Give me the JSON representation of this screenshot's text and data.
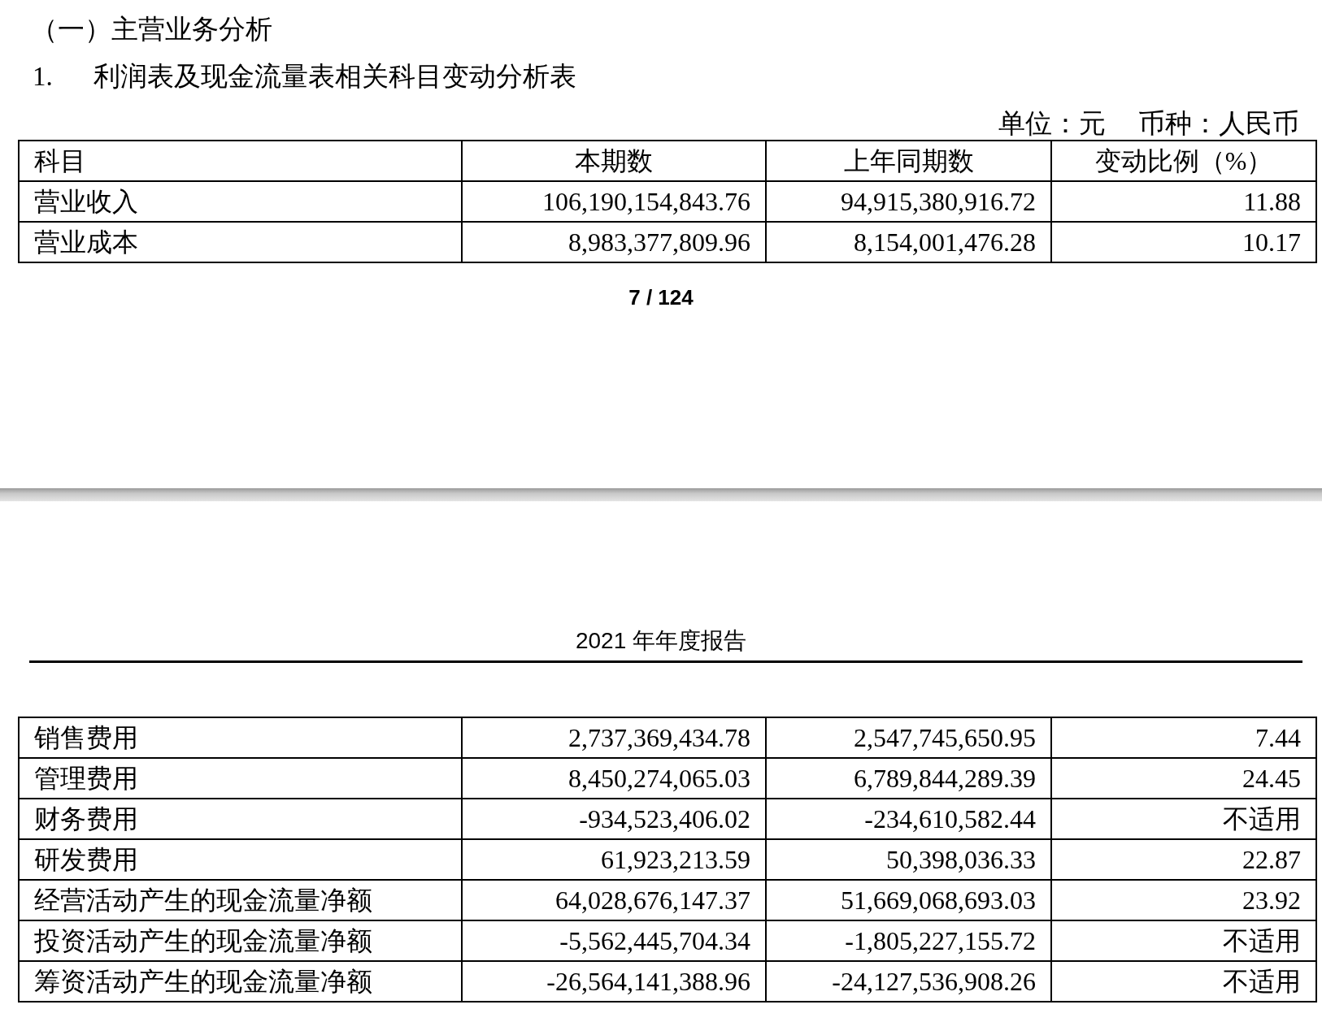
{
  "page_top": {
    "section_heading": "（一）主营业务分析",
    "table_title_number": "1.",
    "table_title": "利润表及现金流量表相关科目变动分析表",
    "unit_note": "单位：元",
    "currency_note": "币种：人民币",
    "table": {
      "columns": [
        "科目",
        "本期数",
        "上年同期数",
        "变动比例（%）"
      ],
      "rows": [
        {
          "cells": [
            "营业收入",
            "106,190,154,843.76",
            "94,915,380,916.72",
            "11.88"
          ]
        },
        {
          "cells": [
            "营业成本",
            "8,983,377,809.96",
            "8,154,001,476.28",
            "10.17"
          ]
        }
      ]
    },
    "page_number": "7 / 124"
  },
  "page_bottom": {
    "running_header": "2021 年年度报告",
    "table": {
      "rows": [
        {
          "cells": [
            "销售费用",
            "2,737,369,434.78",
            "2,547,745,650.95",
            "7.44"
          ]
        },
        {
          "cells": [
            "管理费用",
            "8,450,274,065.03",
            "6,789,844,289.39",
            "24.45"
          ]
        },
        {
          "cells": [
            "财务费用",
            "-934,523,406.02",
            "-234,610,582.44",
            "不适用"
          ]
        },
        {
          "cells": [
            "研发费用",
            "61,923,213.59",
            "50,398,036.33",
            "22.87"
          ]
        },
        {
          "cells": [
            "经营活动产生的现金流量净额",
            "64,028,676,147.37",
            "51,669,068,693.03",
            "23.92"
          ]
        },
        {
          "cells": [
            "投资活动产生的现金流量净额",
            "-5,562,445,704.34",
            "-1,805,227,155.72",
            "不适用"
          ]
        },
        {
          "cells": [
            "筹资活动产生的现金流量净额",
            "-26,564,141,388.96",
            "-24,127,536,908.26",
            "不适用"
          ]
        }
      ]
    }
  }
}
